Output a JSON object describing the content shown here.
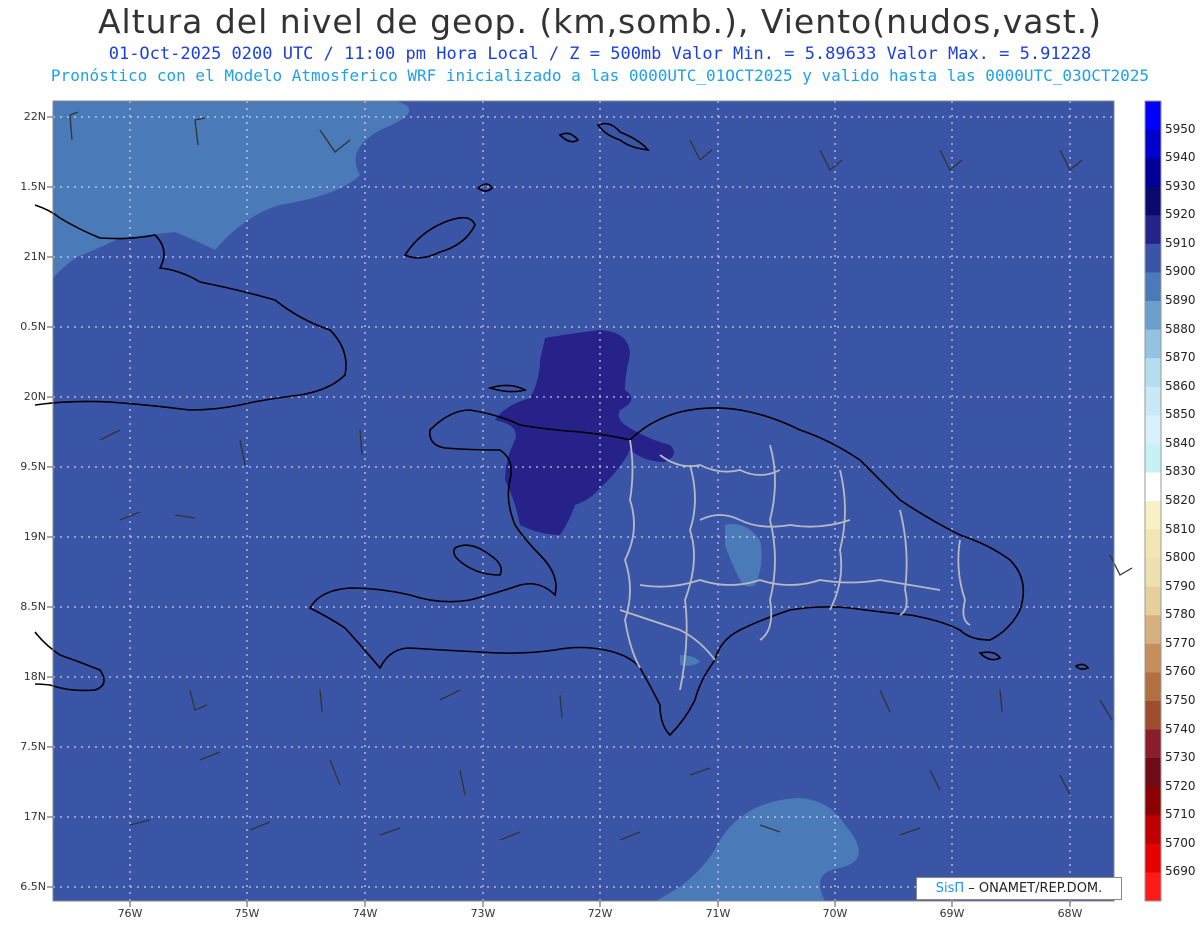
{
  "title": "Altura del nivel de geop. (km,somb.), Viento(nudos,vast.)",
  "subtitle_1": "01-Oct-2025  0200 UTC / 11:00 pm Hora Local / Z = 500mb    Valor Min. = 5.89633  Valor Max. = 5.91228",
  "subtitle_2": "Pronóstico con el Modelo Atmosferico WRF inicializado a las 0000UTC_01OCT2025 y valido hasta las  0000UTC_03OCT2025",
  "latitude_labels": [
    "22N",
    "1.5N",
    "21N",
    "0.5N",
    "20N",
    "9.5N",
    "19N",
    "8.5N",
    "18N",
    "7.5N",
    "17N",
    "6.5N"
  ],
  "longitude_labels": [
    "76W",
    "75W",
    "74W",
    "73W",
    "72W",
    "71W",
    "70W",
    "69W",
    "68W"
  ],
  "colorbar": {
    "levels": [
      "5950",
      "5940",
      "5930",
      "5920",
      "5910",
      "5900",
      "5890",
      "5880",
      "5870",
      "5860",
      "5850",
      "5840",
      "5830",
      "5820",
      "5810",
      "5800",
      "5790",
      "5780",
      "5770",
      "5760",
      "5750",
      "5740",
      "5730",
      "5720",
      "5710",
      "5700",
      "5690"
    ],
    "colors": [
      "#0000ff",
      "#0000cc",
      "#000099",
      "#0a0a6e",
      "#26228a",
      "#3a55a6",
      "#4a7ab8",
      "#6a9fcc",
      "#93c3e0",
      "#b4ddef",
      "#c8e9f5",
      "#d8f1fa",
      "#c6f2f6",
      "#ffffff",
      "#f8f1c6",
      "#f3e6b5",
      "#ede0b0",
      "#e6cf9b",
      "#d6b07e",
      "#c48f5c",
      "#b07040",
      "#9e4d2f",
      "#8a1d2a",
      "#6e0b14",
      "#8c0000",
      "#bf0000",
      "#e60000",
      "#ff1a1a"
    ]
  },
  "colors": {
    "field_base": "#3a55a6",
    "field_low": "#4a7ab8",
    "field_high": "#26228a",
    "coast": "#000000",
    "province_border": "#b8b8c4",
    "grid": "#e8e8ff"
  },
  "credit": {
    "brand": "SisΠ",
    "text": " – ONAMET/REP.DOM."
  }
}
